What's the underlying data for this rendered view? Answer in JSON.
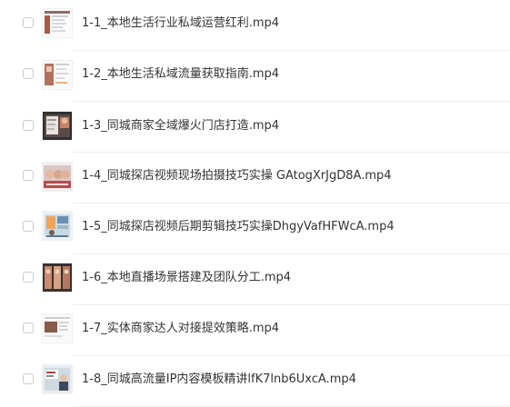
{
  "files": [
    {
      "name": "1-1_本地生活行业私域运营红利.mp4",
      "thumb": "video-thumbnail-icon"
    },
    {
      "name": "1-2_本地生活私域流量获取指南.mp4",
      "thumb": "video-thumbnail-icon"
    },
    {
      "name": "1-3_同城商家全域爆火门店打造.mp4",
      "thumb": "video-thumbnail-icon"
    },
    {
      "name": "1-4_同城探店视频现场拍摄技巧实操 GAtogXrJgD8A.mp4",
      "thumb": "video-thumbnail-icon"
    },
    {
      "name": "1-5_同城探店视频后期剪辑技巧实操DhgyVafHFWcA.mp4",
      "thumb": "video-thumbnail-icon"
    },
    {
      "name": "1-6_本地直播场景搭建及团队分工.mp4",
      "thumb": "video-thumbnail-icon"
    },
    {
      "name": "1-7_实体商家达人对接提效策略.mp4",
      "thumb": "video-thumbnail-icon"
    },
    {
      "name": "1-8_同城高流量IP内容模板精讲lfK7lnb6UxcA.mp4",
      "thumb": "video-thumbnail-icon"
    }
  ]
}
